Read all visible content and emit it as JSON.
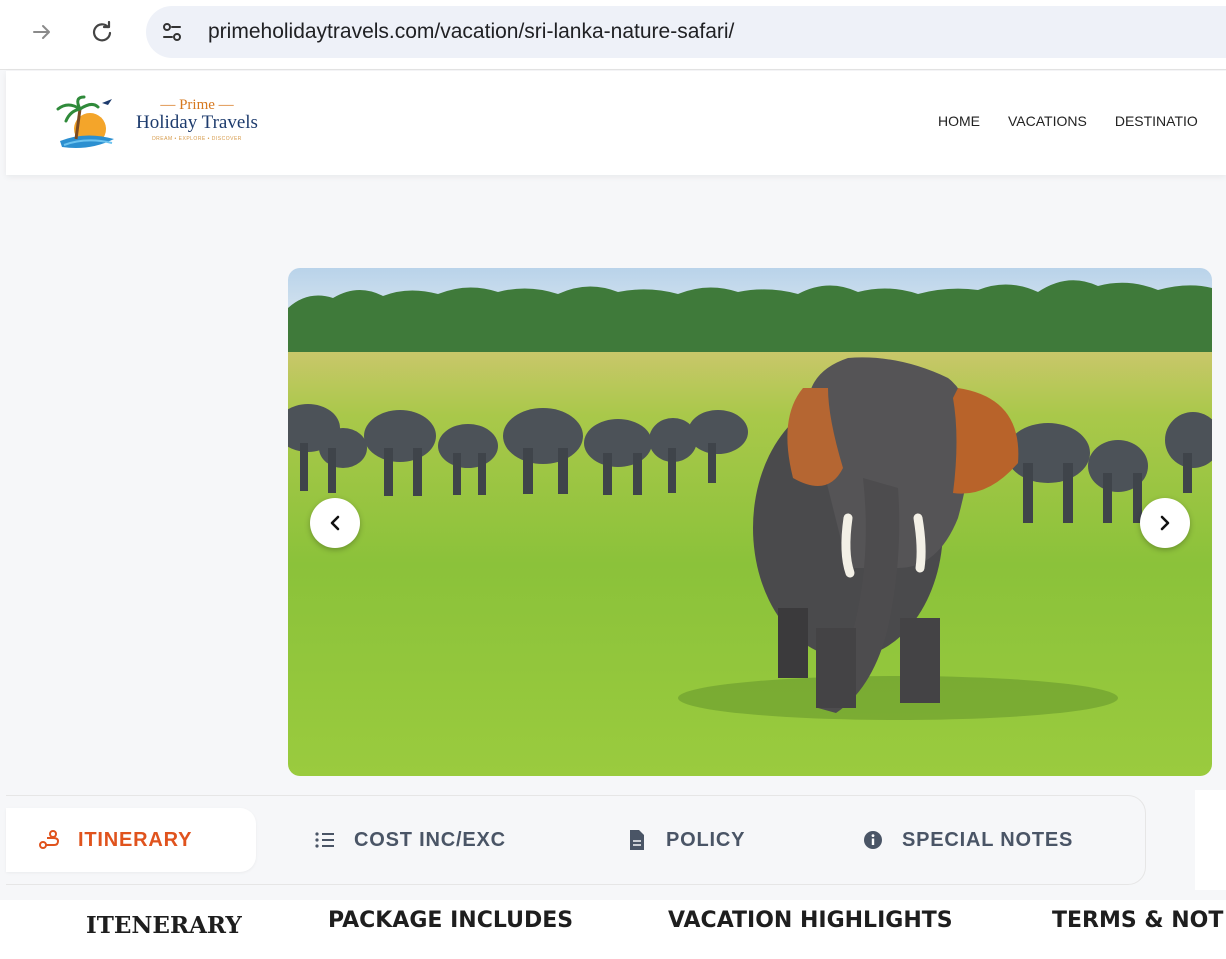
{
  "browser": {
    "url": "primeholidaytravels.com/vacation/sri-lanka-nature-safari/"
  },
  "logo": {
    "prime": "— Prime —",
    "name": "Holiday Travels",
    "tagline": "DREAM • EXPLORE • DISCOVER"
  },
  "nav": {
    "items": [
      {
        "label": "HOME"
      },
      {
        "label": "VACATIONS"
      },
      {
        "label": "DESTINATIO"
      }
    ]
  },
  "tabs": [
    {
      "label": "ITINERARY",
      "icon": "route-icon",
      "active": true
    },
    {
      "label": "COST INC/EXC",
      "icon": "list-icon",
      "active": false
    },
    {
      "label": "POLICY",
      "icon": "document-icon",
      "active": false
    },
    {
      "label": "SPECIAL NOTES",
      "icon": "info-icon",
      "active": false
    }
  ],
  "sections": [
    {
      "label": "ITENERARY"
    },
    {
      "label": "PACKAGE INCLUDES"
    },
    {
      "label": "VACATION HIGHLIGHTS"
    },
    {
      "label": "TERMS  & NOT"
    }
  ],
  "colors": {
    "accent": "#e0531d",
    "tab_text": "#4a5566",
    "brand_blue": "#1d3b6d"
  }
}
